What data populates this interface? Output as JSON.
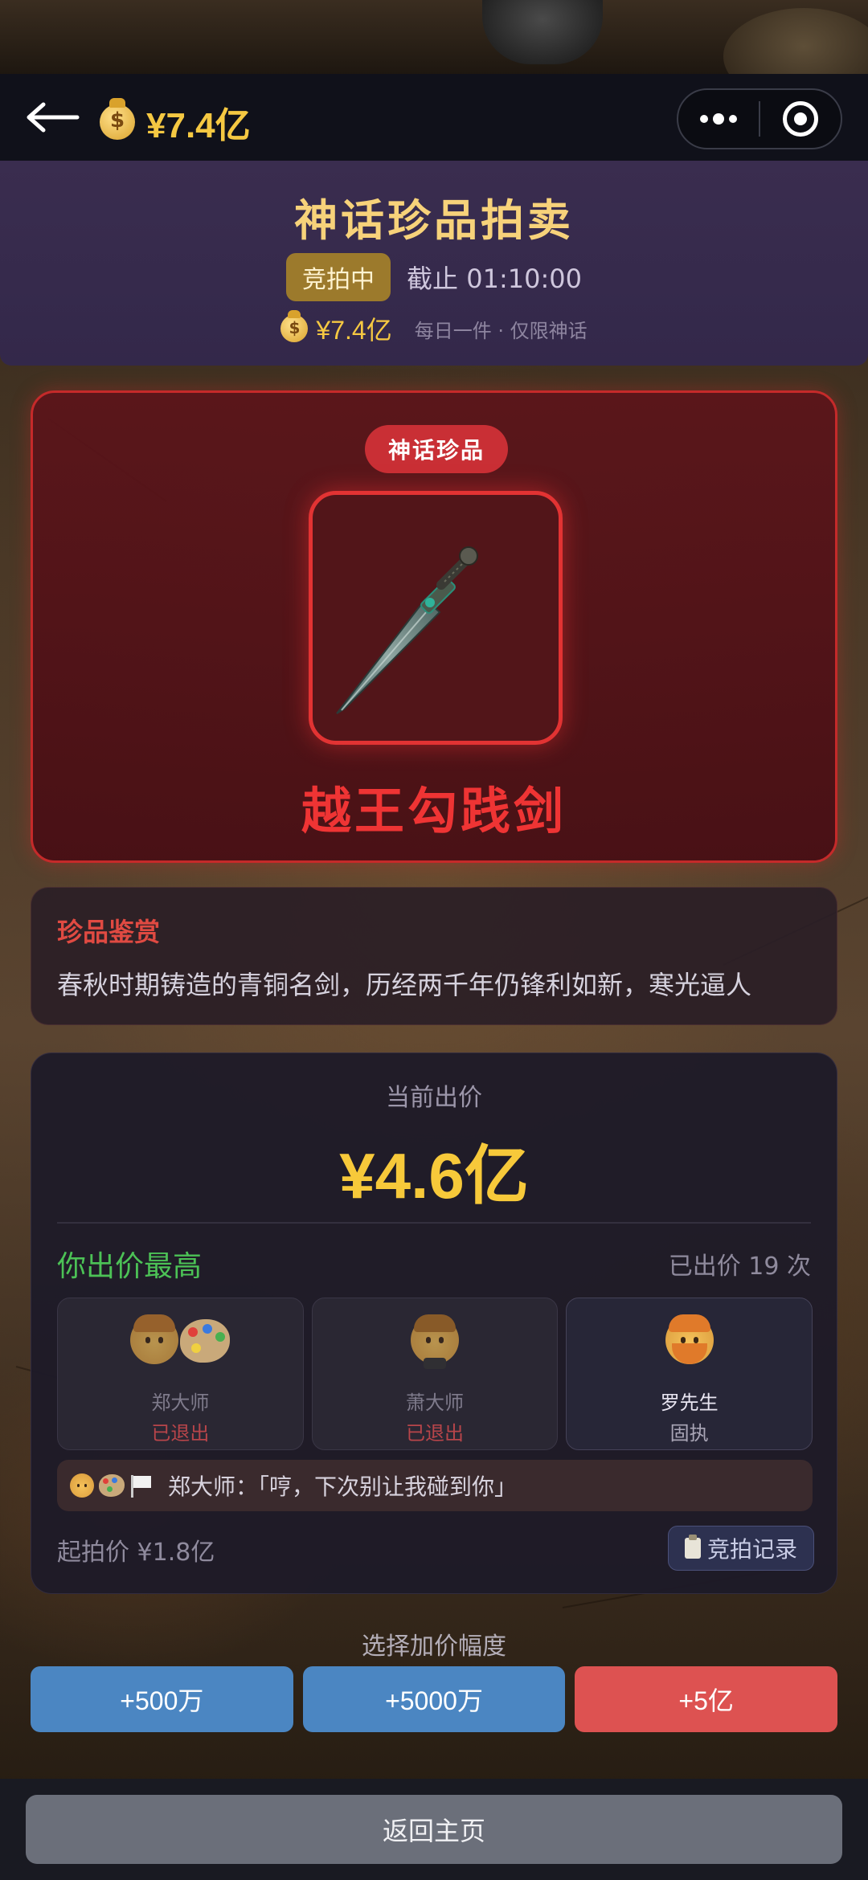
{
  "header": {
    "balance": "¥7.4亿",
    "icons": {
      "back": "back-arrow-icon",
      "coin": "money-bag-icon",
      "more": "more-dots-icon",
      "close": "target-close-icon"
    }
  },
  "banner": {
    "title": "神话珍品拍卖",
    "status": "竞拍中",
    "deadline": "截止 01:10:00",
    "balance": "¥7.4亿",
    "note": "每日一件 · 仅限神话"
  },
  "item": {
    "rarity": "神话珍品",
    "name": "越王勾践剑",
    "image_icon": "bronze-sword-icon"
  },
  "appraisal": {
    "title": "珍品鉴赏",
    "text": "春秋时期铸造的青铜名剑，历经两千年仍锋利如新，寒光逼人"
  },
  "bid": {
    "label": "当前出价",
    "amount": "¥4.6亿",
    "leader_text": "你出价最高",
    "count": "已出价 19 次",
    "bidders": [
      {
        "name": "郑大师",
        "status": "已退出",
        "active": false
      },
      {
        "name": "萧大师",
        "status": "已退出",
        "active": false
      },
      {
        "name": "罗先生",
        "status": "固执",
        "active": true
      }
    ],
    "quote": "郑大师：「哼，下次别让我碰到你」",
    "start_price": "起拍价 ¥1.8亿",
    "history_button": "竞拍记录"
  },
  "increment": {
    "label": "选择加价幅度",
    "options": [
      "+500万",
      "+5000万",
      "+5亿"
    ]
  },
  "footer": {
    "home_button": "返回主页"
  },
  "colors": {
    "gold": "#f5c842",
    "mythic_red": "#ef3434",
    "leader_green": "#4cc256",
    "blue_button": "#4b86c2",
    "red_button": "#dd5251"
  }
}
